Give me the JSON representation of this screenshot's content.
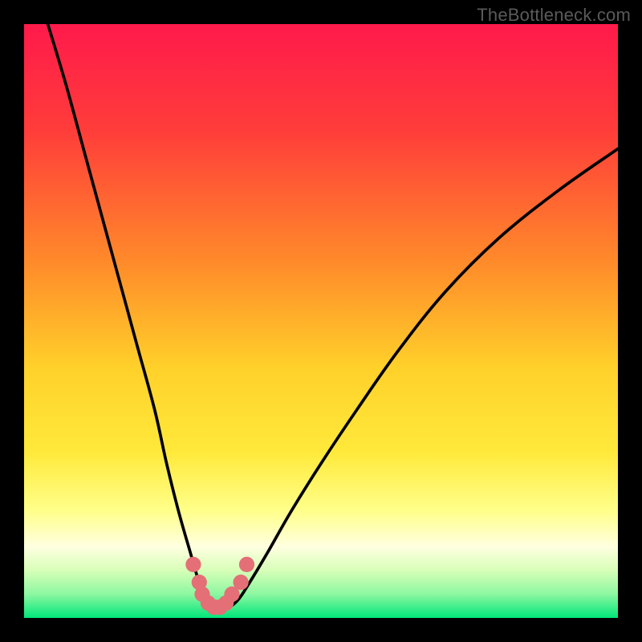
{
  "watermark": {
    "text": "TheBottleneck.com"
  },
  "colors": {
    "frame": "#000000",
    "curve": "#000000",
    "marker_fill": "#e46f76",
    "gradient_stops": [
      {
        "pos": 0.0,
        "color": "#ff1a4b"
      },
      {
        "pos": 0.18,
        "color": "#ff3d3a"
      },
      {
        "pos": 0.4,
        "color": "#ff8a2a"
      },
      {
        "pos": 0.58,
        "color": "#ffd12a"
      },
      {
        "pos": 0.72,
        "color": "#ffe93a"
      },
      {
        "pos": 0.82,
        "color": "#ffff8a"
      },
      {
        "pos": 0.88,
        "color": "#ffffe0"
      },
      {
        "pos": 0.92,
        "color": "#d7ffb8"
      },
      {
        "pos": 0.96,
        "color": "#8cf7a1"
      },
      {
        "pos": 1.0,
        "color": "#00e67a"
      }
    ]
  },
  "chart_data": {
    "type": "line",
    "title": "",
    "xlabel": "",
    "ylabel": "",
    "xlim": [
      0,
      100
    ],
    "ylim": [
      0,
      100
    ],
    "series": [
      {
        "name": "bottleneck-curve",
        "x": [
          4,
          7,
          10,
          13,
          16,
          19,
          22,
          24,
          26,
          28,
          29.5,
          31,
          32.5,
          34,
          36,
          38,
          41,
          45,
          50,
          56,
          63,
          71,
          80,
          90,
          100
        ],
        "y": [
          100,
          90,
          79,
          68,
          57,
          46,
          35,
          26,
          18,
          11,
          6,
          3,
          1.5,
          1.5,
          3,
          6,
          11,
          18,
          26,
          35,
          45,
          55,
          64,
          72,
          79
        ]
      }
    ],
    "markers": {
      "name": "highlight-dots",
      "x": [
        28.5,
        29.5,
        30.0,
        31.0,
        32.0,
        33.0,
        34.0,
        35.0,
        36.5,
        37.5
      ],
      "y": [
        9.0,
        6.0,
        4.0,
        2.5,
        1.8,
        1.8,
        2.5,
        4.0,
        6.0,
        9.0
      ]
    }
  }
}
